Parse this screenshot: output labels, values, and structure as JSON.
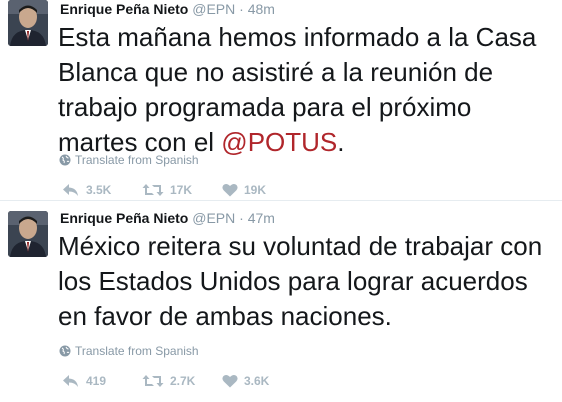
{
  "tweets": [
    {
      "author": "Enrique Peña Nieto",
      "handle": "@EPN",
      "separator": "·",
      "time": "48m",
      "text_before": "Esta mañana hemos informado a la Casa Blanca que no asistiré a la reunión de trabajo programada para el próximo martes con el ",
      "mention": "@POTUS",
      "text_after": ".",
      "translate_label": "Translate from Spanish",
      "replies": "3.5K",
      "retweets": "17K",
      "likes": "19K"
    },
    {
      "author": "Enrique Peña Nieto",
      "handle": "@EPN",
      "separator": "·",
      "time": "47m",
      "text_before": "México reitera su voluntad de trabajar con los Estados Unidos para lograr acuerdos en favor de ambas naciones.",
      "mention": "",
      "text_after": "",
      "translate_label": "Translate from Spanish",
      "replies": "419",
      "retweets": "2.7K",
      "likes": "3.6K"
    }
  ],
  "colors": {
    "mention": "#b0262b",
    "meta": "#8899a6",
    "action": "#aab8c2"
  },
  "icons": [
    "globe-icon",
    "reply-icon",
    "retweet-icon",
    "heart-icon"
  ]
}
